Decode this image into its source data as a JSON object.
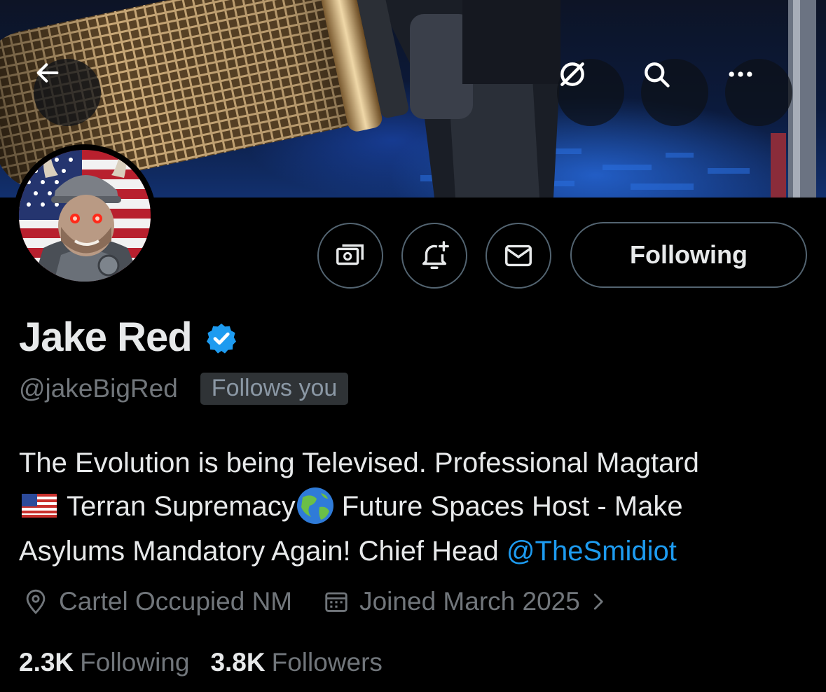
{
  "header": {
    "back_icon": "arrow-left-icon",
    "grok_icon": "grok-icon",
    "search_icon": "search-icon",
    "more_icon": "more-horizontal-icon"
  },
  "profile": {
    "display_name": "Jake Red",
    "verified": true,
    "verified_color": "#1d9bf0",
    "handle": "@jakeBigRed",
    "follows_you_badge": "Follows you",
    "bio": {
      "line1": "The Evolution is being Televised. Professional Magtard",
      "line2_part1": "Terran Supremacy",
      "line2_part2": "Future Spaces Host - Make",
      "line3_part1": "Asylums Mandatory Again! Chief Head",
      "mention": "@TheSmidiot"
    },
    "location": "Cartel Occupied NM",
    "joined": "Joined March 2025",
    "following_count": "2.3K",
    "following_label": "Following",
    "followers_count": "3.8K",
    "followers_label": "Followers"
  },
  "actions": {
    "subscribe_icon": "money-icon",
    "notify_icon": "bell-plus-icon",
    "message_icon": "envelope-icon",
    "following_button": "Following"
  },
  "colors": {
    "background": "#000000",
    "text_primary": "#e7e9ea",
    "text_secondary": "#71767b",
    "link": "#1d9bf0",
    "border": "#536471"
  }
}
